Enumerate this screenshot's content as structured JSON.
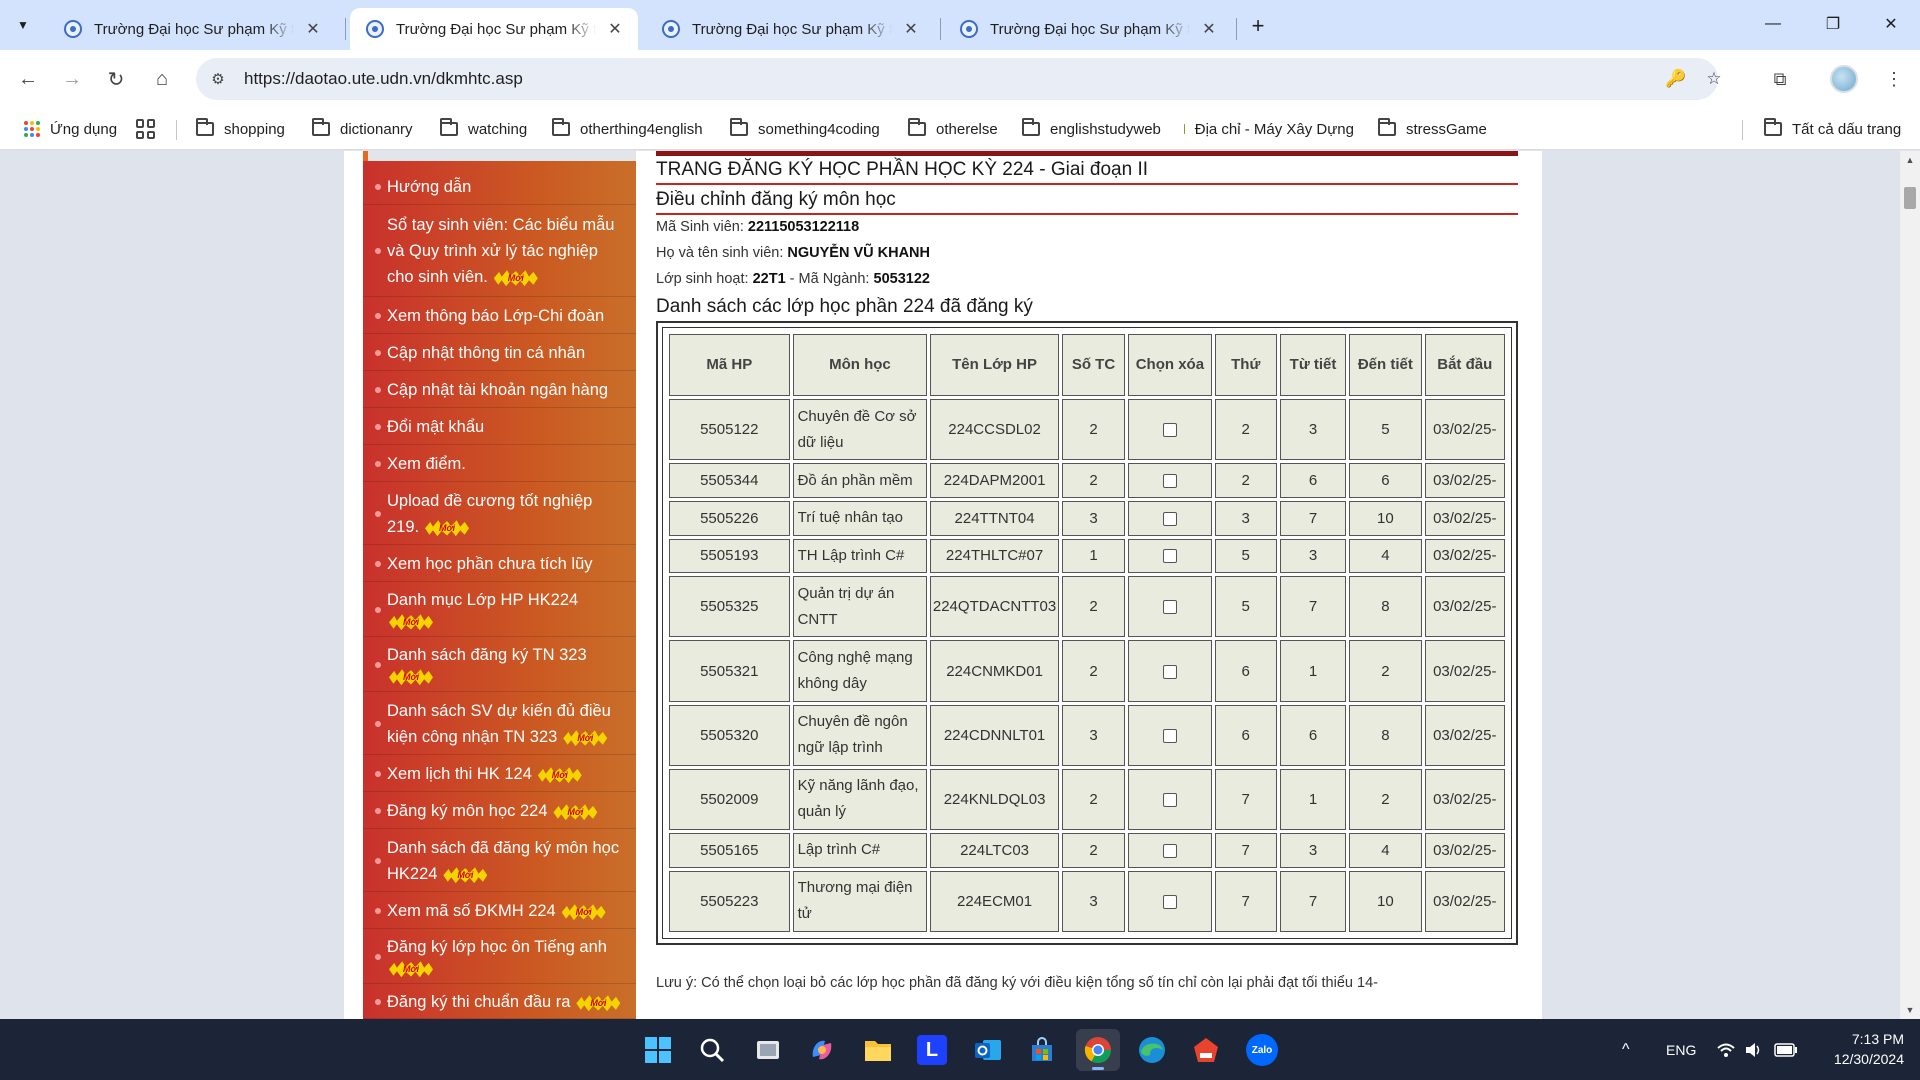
{
  "browser": {
    "tab_dropdown_icon": "chevron-down-icon",
    "tabs": [
      {
        "title": "Trường Đại học Sư phạm Kỹ thuật - ĐH Đà Nẵng",
        "active": false
      },
      {
        "title": "Trường Đại học Sư phạm Kỹ thuật - ĐH Đà Nẵng",
        "active": true
      },
      {
        "title": "Trường Đại học Sư phạm Kỹ thuật - ĐH Đà Nẵng",
        "active": false
      },
      {
        "title": "Trường Đại học Sư phạm Kỹ thuật - ĐH Đà Nẵng",
        "active": false
      }
    ],
    "close_glyph": "✕",
    "new_tab_glyph": "+",
    "window_controls": {
      "minimize": "—",
      "restore": "❐",
      "close": "✕"
    },
    "nav": {
      "back": "←",
      "forward": "→",
      "reload": "↻",
      "home": "⌂"
    },
    "url": "https://daotao.ute.udn.vn/dkmhtc.asp",
    "site_info_glyph": "⚙",
    "omnibox_icons": {
      "password": "🔑",
      "bookmark": "☆"
    },
    "extensions_glyph": "⧉",
    "menu_glyph": "⋮"
  },
  "bookmarks": {
    "apps_label": "Ứng dụng",
    "items": [
      {
        "label": "shopping"
      },
      {
        "label": "dictionanry"
      },
      {
        "label": "watching"
      },
      {
        "label": "otherthing4english"
      },
      {
        "label": "something4coding"
      },
      {
        "label": "otherelse"
      },
      {
        "label": "englishstudyweb"
      },
      {
        "label": "Địa chỉ - Máy Xây Dựng"
      },
      {
        "label": "stressGame"
      }
    ],
    "all_bookmarks": "Tất cả dấu trang"
  },
  "sidebar": {
    "badge_text": "Mới",
    "items": [
      {
        "label": "Hướng dẫn",
        "new": false
      },
      {
        "label": "Sổ tay sinh viên: Các biểu mẫu và Quy trình xử lý tác nghiệp cho sinh viên.",
        "new": true
      },
      {
        "label": "Xem thông báo Lớp-Chi đoàn",
        "new": false
      },
      {
        "label": "Cập nhật thông tin cá nhân",
        "new": false
      },
      {
        "label": "Cập nhật tài khoản ngân hàng",
        "new": false
      },
      {
        "label": "Đổi mật khẩu",
        "new": false
      },
      {
        "label": "Xem điểm.",
        "new": false
      },
      {
        "label": "Upload đề cương tốt nghiệp 219.",
        "new": true
      },
      {
        "label": "Xem học phần chưa tích lũy",
        "new": false
      },
      {
        "label": "Danh mục Lớp HP HK224",
        "new": true
      },
      {
        "label": "Danh sách đăng ký TN 323",
        "new": true
      },
      {
        "label": "Danh sách SV dự kiến đủ điều kiện công nhận TN 323",
        "new": true
      },
      {
        "label": "Xem lịch thi HK 124",
        "new": true
      },
      {
        "label": "Đăng ký môn học 224",
        "new": true
      },
      {
        "label": "Danh sách đã đăng ký môn học HK224",
        "new": true
      },
      {
        "label": "Xem mã số ĐKMH 224",
        "new": true
      },
      {
        "label": "Đăng ký lớp học ôn Tiếng anh",
        "new": true
      },
      {
        "label": "Đăng ký thi chuẩn đầu ra",
        "new": true
      }
    ]
  },
  "content": {
    "page_title": "TRANG ĐĂNG KÝ HỌC PHẦN HỌC KỲ 224 - Giai đoạn II",
    "section_title": "Điều chỉnh đăng ký môn học",
    "student_id_label": "Mã Sinh viên:",
    "student_id": "22115053122118",
    "name_label": "Họ và tên sinh viên:",
    "name": "NGUYỄN VŨ KHANH",
    "class_label": "Lớp sinh hoạt:",
    "class": "22T1",
    "major_label": "- Mã Ngành:",
    "major": "5053122",
    "list_title": "Danh sách các lớp học phần 224 đã đăng ký",
    "table": {
      "headers": [
        "Mã HP",
        "Môn học",
        "Tên Lớp HP",
        "Số TC",
        "Chọn xóa",
        "Thứ",
        "Từ tiết",
        "Đến tiết",
        "Bắt đầu"
      ],
      "rows": [
        {
          "ma_hp": "5505122",
          "mon_hoc": "Chuyên đề Cơ sở dữ liệu",
          "ten_lop": "224CCSDL02",
          "so_tc": "2",
          "thu": "2",
          "tu_tiet": "3",
          "den_tiet": "5",
          "bat_dau": "03/02/25-"
        },
        {
          "ma_hp": "5505344",
          "mon_hoc": "Đồ án phần mềm",
          "ten_lop": "224DAPM2001",
          "so_tc": "2",
          "thu": "2",
          "tu_tiet": "6",
          "den_tiet": "6",
          "bat_dau": "03/02/25-"
        },
        {
          "ma_hp": "5505226",
          "mon_hoc": "Trí tuệ nhân tạo",
          "ten_lop": "224TTNT04",
          "so_tc": "3",
          "thu": "3",
          "tu_tiet": "7",
          "den_tiet": "10",
          "bat_dau": "03/02/25-"
        },
        {
          "ma_hp": "5505193",
          "mon_hoc": "TH Lập trình C#",
          "ten_lop": "224THLTC#07",
          "so_tc": "1",
          "thu": "5",
          "tu_tiet": "3",
          "den_tiet": "4",
          "bat_dau": "03/02/25-"
        },
        {
          "ma_hp": "5505325",
          "mon_hoc": "Quản trị dự án CNTT",
          "ten_lop": "224QTDACNTT03",
          "so_tc": "2",
          "thu": "5",
          "tu_tiet": "7",
          "den_tiet": "8",
          "bat_dau": "03/02/25-"
        },
        {
          "ma_hp": "5505321",
          "mon_hoc": "Công nghệ mạng không dây",
          "ten_lop": "224CNMKD01",
          "so_tc": "2",
          "thu": "6",
          "tu_tiet": "1",
          "den_tiet": "2",
          "bat_dau": "03/02/25-"
        },
        {
          "ma_hp": "5505320",
          "mon_hoc": "Chuyên đề ngôn ngữ lập trình",
          "ten_lop": "224CDNNLT01",
          "so_tc": "3",
          "thu": "6",
          "tu_tiet": "6",
          "den_tiet": "8",
          "bat_dau": "03/02/25-"
        },
        {
          "ma_hp": "5502009",
          "mon_hoc": "Kỹ năng lãnh đạo, quản lý",
          "ten_lop": "224KNLDQL03",
          "so_tc": "2",
          "thu": "7",
          "tu_tiet": "1",
          "den_tiet": "2",
          "bat_dau": "03/02/25-"
        },
        {
          "ma_hp": "5505165",
          "mon_hoc": "Lập trình C#",
          "ten_lop": "224LTC03",
          "so_tc": "2",
          "thu": "7",
          "tu_tiet": "3",
          "den_tiet": "4",
          "bat_dau": "03/02/25-"
        },
        {
          "ma_hp": "5505223",
          "mon_hoc": "Thương mại điện tử",
          "ten_lop": "224ECM01",
          "so_tc": "3",
          "thu": "7",
          "tu_tiet": "7",
          "den_tiet": "10",
          "bat_dau": "03/02/25-"
        }
      ]
    },
    "note": "Lưu ý: Có thể chọn loại bỏ các lớp học phần đã đăng ký với điều kiện tổng số tín chỉ còn lại phải đạt tối thiểu 14-"
  },
  "taskbar": {
    "apps": [
      {
        "name": "start",
        "icon": "windows-icon"
      },
      {
        "name": "search",
        "icon": "search-icon"
      },
      {
        "name": "task-view",
        "icon": "task-view-icon"
      },
      {
        "name": "copilot",
        "icon": "copilot-icon"
      },
      {
        "name": "file-explorer",
        "icon": "folder-icon"
      },
      {
        "name": "app-l",
        "icon": "l-app-icon",
        "glyph": "L"
      },
      {
        "name": "outlook",
        "icon": "outlook-icon"
      },
      {
        "name": "store",
        "icon": "store-icon"
      },
      {
        "name": "chrome",
        "icon": "chrome-icon",
        "active": true
      },
      {
        "name": "edge",
        "icon": "edge-icon"
      },
      {
        "name": "app-red",
        "icon": "red-app-icon"
      },
      {
        "name": "zalo",
        "icon": "zalo-icon",
        "glyph": "Zalo"
      }
    ],
    "tray": {
      "chevron": "^",
      "language": "ENG"
    },
    "time": "7:13 PM",
    "date": "12/30/2024"
  },
  "colors": {
    "tab_bar_bg": "#d3e3fd",
    "sidebar_start": "#c9312c",
    "sidebar_end": "#c96f2a",
    "title_rule": "#c82323",
    "table_cell_bg": "#e9ebde",
    "taskbar_bg": "#1c2537"
  }
}
